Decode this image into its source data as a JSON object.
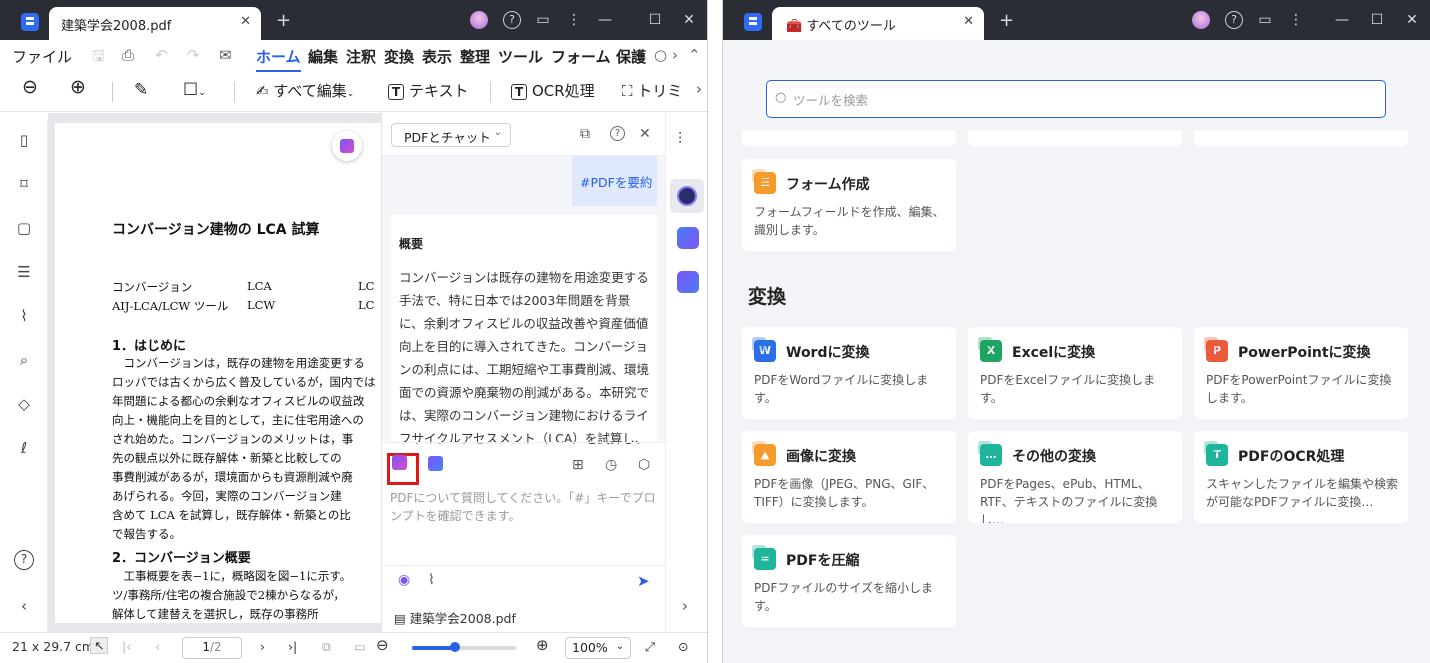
{
  "left_window": {
    "tab_title": "建築学会2008.pdf",
    "menu": [
      "ファイル",
      "ホーム",
      "編集",
      "注釈",
      "変換",
      "表示",
      "整理",
      "ツール",
      "フォーム",
      "保護"
    ],
    "active_menu": "ホーム",
    "toolbar": {
      "edit_all": "すべて編集",
      "text": "テキスト",
      "ocr": "OCR処理",
      "trim": "トリミ"
    },
    "document": {
      "title": "コンバージョン建物の LCA 試算",
      "kw_row1": [
        "コンバージョン",
        "LCA",
        "LC"
      ],
      "kw_row2": [
        "AIJ-LCA/LCW ツール",
        "LCW",
        "LC"
      ],
      "h1": "1．はじめに",
      "p1": [
        "　コンバージョンは，既存の建物を用途変更する",
        "ロッパでは古くから広く普及しているが，国内では",
        "年問題による都心の余剰なオフィスビルの収益改",
        "向上・機能向上を目的として，主に住宅用途への",
        "され始めた。コンバージョンのメリットは，事",
        "先の観点以外に既存解体・新築と比較しての",
        "事費削減があるが，環境面からも資源削減や廃",
        "あげられる。今回，実際のコンバージョン建",
        "含めて LCA を試算し，既存解体・新築との比",
        "で報告する。"
      ],
      "h2": "2．コンバージョン概要",
      "p2": [
        "　工事概要を表−1に，概略図を図−1に示す。",
        "ツ/事務所/住宅の複合施設で2棟からなるが，",
        "解体して建替えを選択し，既存の事務所"
      ]
    },
    "chat": {
      "mode": "PDFとチャット",
      "user_message": "#PDFを要約",
      "answer_heading": "概要",
      "answer_body": "コンバージョンは既存の建物を用途変更する手法で、特に日本では2003年問題を背景に、余剰オフィスビルの収益改善や資産価値向上を目的に導入されてきた。コンバージョンの利点には、工期短縮や工事費削減、環境面での資源や廃棄物の削減がある。本研究では、実際のコンバージョン建物におけるライフサイクルアセスメント（LCA）を試算し、解体",
      "prompt_placeholder": "PDFについて質問してください。「#」キーでプロンプトを確認できます。",
      "file_name": "建築学会2008.pdf"
    },
    "status": {
      "page_size": "21 x 29.7 cm",
      "page_current": "1",
      "page_total": "/2",
      "zoom": "100%",
      "zoom_fraction": 0.41
    }
  },
  "right_window": {
    "tab_title": "すべてのツール",
    "search_placeholder": "ツールを検索",
    "form_card": {
      "title": "フォーム作成",
      "desc": "フォームフィールドを作成、編集、識別します。",
      "color": "#f59b2b"
    },
    "convert_section": "変換",
    "cards": [
      {
        "title": "Wordに変換",
        "desc": "PDFをWordファイルに変換します。",
        "color": "#2b6fe6",
        "glyph": "W"
      },
      {
        "title": "Excelに変換",
        "desc": "PDFをExcelファイルに変換します。",
        "color": "#1fa463",
        "glyph": "X"
      },
      {
        "title": "PowerPointに変換",
        "desc": "PDFをPowerPointファイルに変換します。",
        "color": "#ea5a3c",
        "glyph": "P"
      },
      {
        "title": "画像に変換",
        "desc": "PDFを画像（JPEG、PNG、GIF、TIFF）に変換します。",
        "color": "#f59b2b",
        "glyph": "▲"
      },
      {
        "title": "その他の変換",
        "desc": "PDFをPages、ePub、HTML、RTF、テキストのファイルに変換し…",
        "color": "#1fb59a",
        "glyph": "…"
      },
      {
        "title": "PDFのOCR処理",
        "desc": "スキャンしたファイルを編集や検索が可能なPDFファイルに変換…",
        "color": "#1fb59a",
        "glyph": "T"
      },
      {
        "title": "PDFを圧縮",
        "desc": "PDFファイルのサイズを縮小します。",
        "color": "#1fb59a",
        "glyph": "="
      }
    ]
  }
}
